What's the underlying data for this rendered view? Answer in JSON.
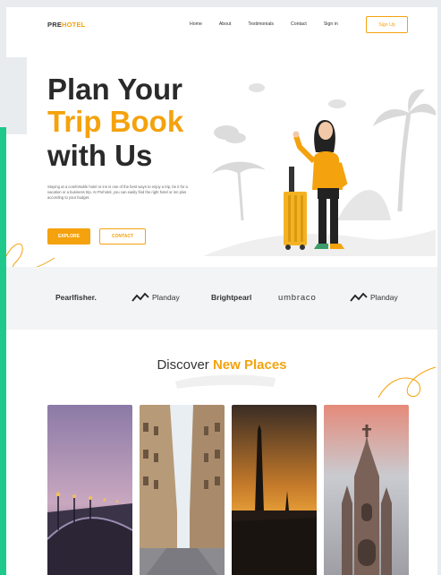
{
  "header": {
    "logo_prefix": "PRE",
    "logo_suffix": "HOTEL",
    "nav": [
      "Home",
      "About",
      "Testimonials",
      "Contact",
      "Sign in"
    ],
    "signup_label": "Sign Up"
  },
  "hero": {
    "title_line1": "Plan Your",
    "title_line2": "Trip Book",
    "title_line3": "with Us",
    "description": "Staying at a comfortable hotel or inn is one of the best ways to enjoy a trip, be it for a vacation or a business trip. At Prehotel, you can easily find the right hotel or inn plus according to your budget.",
    "explore_label": "EXPLORE",
    "contact_label": "CONTACT"
  },
  "partners": [
    "Pearlfisher.",
    "Planday",
    "Brightpearl",
    "umbraco",
    "Planday"
  ],
  "discover": {
    "title_plain": "Discover ",
    "title_highlight": "New Places"
  },
  "colors": {
    "accent": "#f4a20d",
    "side_bar": "#1fc98b",
    "text_dark": "#2a2a2a"
  }
}
